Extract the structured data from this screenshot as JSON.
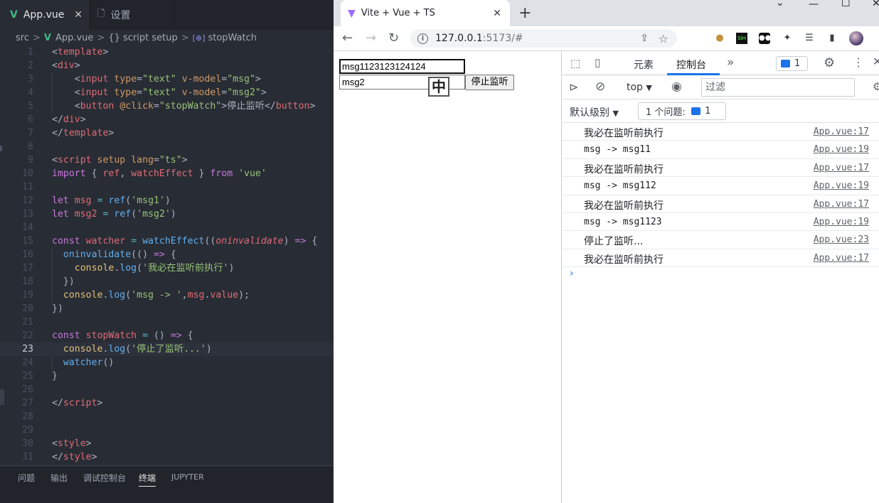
{
  "editor": {
    "tabs": [
      {
        "label": "App.vue",
        "close": "✕"
      },
      {
        "label": "设置"
      }
    ],
    "breadcrumb": [
      "src",
      "App.vue",
      "{} script setup",
      "stopWatch"
    ],
    "breadcrumb_sep": ">",
    "line_numbers": [
      "1",
      "2",
      "3",
      "4",
      "5",
      "6",
      "7",
      "8",
      "9",
      "10",
      "11",
      "12",
      "13",
      "14",
      "15",
      "16",
      "17",
      "18",
      "19",
      "20",
      "21",
      "22",
      "23",
      "24",
      "25",
      "26",
      "27",
      "28",
      "29",
      "30",
      "31"
    ],
    "current_line": 23,
    "code": {
      "l1": [
        "<",
        "template",
        ">"
      ],
      "l2": [
        "<",
        "div",
        ">"
      ],
      "l3": [
        "<",
        "input",
        "type",
        "=",
        "\"text\"",
        "v-model",
        "=",
        "\"msg\"",
        ">"
      ],
      "l4": [
        "<",
        "input",
        "type",
        "=",
        "\"text\"",
        "v-model",
        "=",
        "\"msg2\"",
        ">"
      ],
      "l5": [
        "<",
        "button",
        "@click",
        "=",
        "\"stopWatch\"",
        ">停止监听</",
        "button",
        ">"
      ],
      "l6": [
        "</",
        "div",
        ">"
      ],
      "l7": [
        "</",
        "template",
        ">"
      ],
      "l9": [
        "<",
        "script",
        "setup",
        "lang",
        "=",
        "\"ts\"",
        ">"
      ],
      "l10": [
        "import",
        "{ ",
        "ref",
        ", ",
        "watchEffect",
        " } ",
        "from",
        "'vue'"
      ],
      "l12": [
        "let",
        "msg",
        "=",
        "ref",
        "(",
        "'msg1'",
        ")"
      ],
      "l13": [
        "let",
        "msg2",
        "=",
        "ref",
        "(",
        "'msg2'",
        ")"
      ],
      "l15": [
        "const",
        "watcher",
        "=",
        "watchEffect",
        "((",
        "oninvalidate",
        ")",
        "=>",
        "{"
      ],
      "l16": [
        "oninvalidate",
        "((",
        ")",
        "=>",
        "{"
      ],
      "l17": [
        "console",
        ".",
        "log",
        "(",
        "'我必在监听前执行'",
        ")"
      ],
      "l18": [
        "})"
      ],
      "l19": [
        "console",
        ".",
        "log",
        "(",
        "'msg -> '",
        ",",
        "msg",
        ".",
        "value",
        ");"
      ],
      "l20": [
        "})"
      ],
      "l22": [
        "const",
        "stopWatch",
        "=",
        "()",
        "=>",
        "{"
      ],
      "l23": [
        "console",
        ".",
        "log",
        "(",
        "'停止了监听...'",
        ")"
      ],
      "l24": [
        "watcher",
        "()"
      ],
      "l25": [
        "}"
      ],
      "l27": [
        "</",
        "script",
        ">"
      ],
      "l30": [
        "<",
        "style",
        ">"
      ],
      "l31": [
        "</",
        "style",
        ">"
      ]
    },
    "panel_tabs": [
      "问题",
      "输出",
      "调试控制台",
      "终端",
      "JUPYTER"
    ],
    "panel_active": "终端"
  },
  "browser": {
    "tab_title": "Vite + Vue + TS",
    "tab_close": "✕",
    "new_tab": "+",
    "address": {
      "host": "127.0.0.1",
      "rest": ":5173/#"
    },
    "page": {
      "input1_value": "msg1123123124124",
      "input2_value": "msg2",
      "ime_glyph": "中",
      "button_label": "停止监听"
    }
  },
  "devtools": {
    "tabs": [
      "元素",
      "控制台"
    ],
    "active_tab": "控制台",
    "more": "»",
    "issues_badge": "1",
    "context": "top",
    "filter_placeholder": "过滤",
    "level": "默认级别",
    "issues_button": {
      "label": "1 个问题:",
      "count": "1"
    },
    "logs": [
      {
        "msg": "我必在监听前执行",
        "src": "App.vue:17",
        "mono": false
      },
      {
        "msg": "msg ->  msg11",
        "src": "App.vue:19",
        "mono": true
      },
      {
        "msg": "我必在监听前执行",
        "src": "App.vue:17",
        "mono": false
      },
      {
        "msg": "msg ->  msg112",
        "src": "App.vue:19",
        "mono": true
      },
      {
        "msg": "我必在监听前执行",
        "src": "App.vue:17",
        "mono": false
      },
      {
        "msg": "msg ->  msg1123",
        "src": "App.vue:19",
        "mono": true
      },
      {
        "msg": "停止了监听...",
        "src": "App.vue:23",
        "mono": false
      },
      {
        "msg": "我必在监听前执行",
        "src": "App.vue:17",
        "mono": false
      }
    ],
    "prompt": "›"
  },
  "colors": {
    "editor_bg": "#282c34",
    "vue_green": "#42b883",
    "accent_blue": "#1a73e8"
  }
}
